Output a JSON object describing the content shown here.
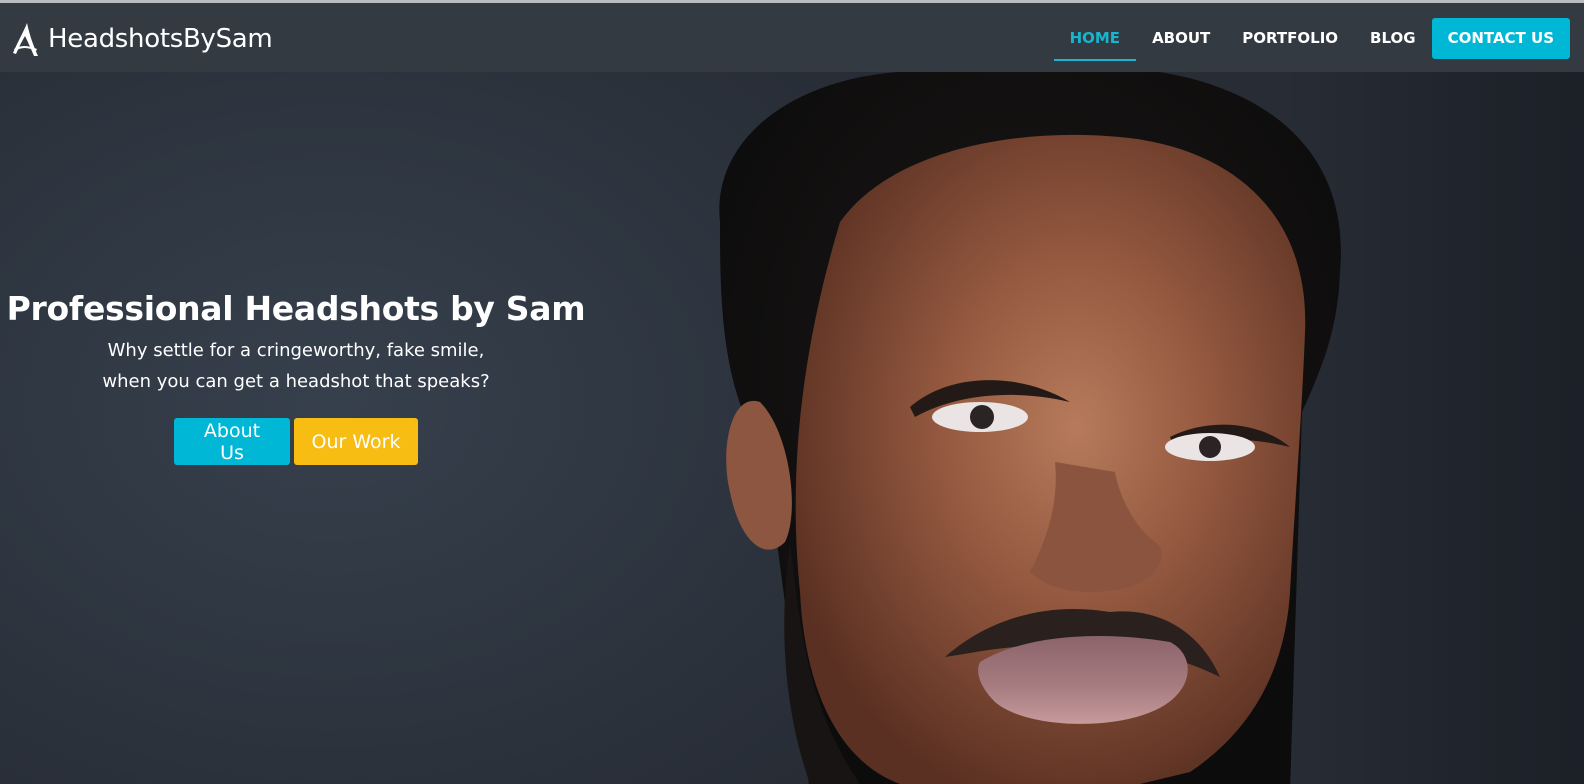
{
  "brand": {
    "name": "HeadshotsBySam",
    "logo_icon": "stylized-a-logo-icon"
  },
  "nav": {
    "items": [
      {
        "label": "HOME",
        "active": true
      },
      {
        "label": "ABOUT",
        "active": false
      },
      {
        "label": "PORTFOLIO",
        "active": false
      },
      {
        "label": "BLOG",
        "active": false
      }
    ],
    "cta_label": "CONTACT US"
  },
  "hero": {
    "title": "Professional Headshots by Sam",
    "subtitle_line1": "Why settle for a cringeworthy, fake smile,",
    "subtitle_line2": "when you can get a headshot that speaks?",
    "buttons": {
      "about_label": "About Us",
      "work_label": "Our Work"
    },
    "image_description_icon": "portrait-photo"
  },
  "colors": {
    "accent_cyan": "#00b8d6",
    "accent_yellow": "#f8bd13",
    "navbar_bg": "#333a41",
    "hero_bg": "#2f3742"
  }
}
